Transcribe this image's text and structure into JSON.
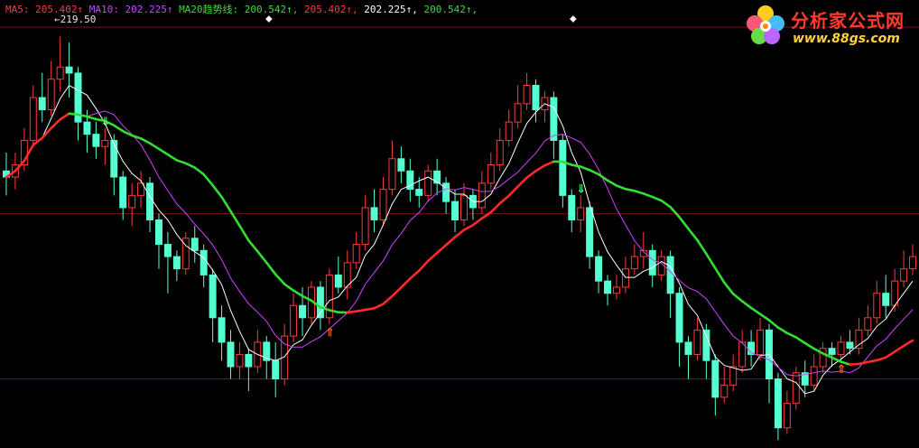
{
  "legend": {
    "ma5_label": "MA5: 205.402↑",
    "ma10_label": "MA10: 202.225↑",
    "ma20_label": "MA20趋势线: 200.542↑,",
    "extra_values": [
      {
        "text": "205.402↑,",
        "color": "#ff3a3a"
      },
      {
        "text": "202.225↑,",
        "color": "#ffffff"
      },
      {
        "text": "200.542↑,",
        "color": "#3ade3a"
      }
    ]
  },
  "high_label": "219.50",
  "watermark": {
    "title": "分析家公式网",
    "url": "www.88gs.com"
  },
  "colors": {
    "up": "#ff3a3a",
    "down": "#54ffd2",
    "ma5": "#ffffff",
    "ma10": "#cc44ff",
    "ma20_up": "#ff2a2a",
    "ma20_down": "#33dd33",
    "grid": "#7a1010",
    "ma5_text": "#ff3a3a",
    "ma10_text": "#cc44ff",
    "ma20_text": "#3ade3a"
  },
  "chart_data": {
    "type": "candlestick",
    "ylim": [
      155,
      225
    ],
    "grid_lines": [
      223.5,
      193,
      166
    ],
    "candles": [
      [
        200,
        199,
        203,
        196
      ],
      [
        199,
        201,
        203,
        197
      ],
      [
        201,
        205,
        207,
        200
      ],
      [
        205,
        212,
        214,
        204
      ],
      [
        212,
        210,
        216,
        208
      ],
      [
        210,
        215,
        218,
        209
      ],
      [
        215,
        217,
        222,
        213
      ],
      [
        217,
        216,
        221,
        212
      ],
      [
        216,
        208,
        217,
        205
      ],
      [
        208,
        206,
        210,
        203
      ],
      [
        206,
        204,
        208,
        202
      ],
      [
        204,
        205,
        207,
        201
      ],
      [
        205,
        199,
        206,
        196
      ],
      [
        199,
        194,
        200,
        192
      ],
      [
        194,
        196,
        198,
        191
      ],
      [
        196,
        198,
        200,
        194
      ],
      [
        198,
        192,
        199,
        190
      ],
      [
        192,
        188,
        193,
        184
      ],
      [
        188,
        186,
        190,
        180
      ],
      [
        186,
        184,
        187,
        182
      ],
      [
        184,
        189,
        190,
        183
      ],
      [
        189,
        187,
        191,
        185
      ],
      [
        187,
        183,
        188,
        181
      ],
      [
        183,
        176,
        184,
        172
      ],
      [
        176,
        172,
        178,
        169
      ],
      [
        172,
        168,
        174,
        166
      ],
      [
        168,
        170,
        172,
        166
      ],
      [
        170,
        168,
        171,
        164
      ],
      [
        168,
        172,
        174,
        167
      ],
      [
        172,
        169,
        173,
        166
      ],
      [
        169,
        166,
        172,
        163
      ],
      [
        166,
        173,
        175,
        165
      ],
      [
        173,
        178,
        180,
        172
      ],
      [
        178,
        176,
        181,
        173
      ],
      [
        176,
        181,
        182,
        175
      ],
      [
        181,
        176,
        182,
        174
      ],
      [
        176,
        183,
        184,
        175
      ],
      [
        183,
        181,
        186,
        180
      ],
      [
        181,
        185,
        187,
        179
      ],
      [
        185,
        188,
        190,
        184
      ],
      [
        188,
        194,
        196,
        187
      ],
      [
        194,
        192,
        197,
        190
      ],
      [
        192,
        197,
        199,
        191
      ],
      [
        197,
        202,
        205,
        196
      ],
      [
        202,
        200,
        204,
        198
      ],
      [
        200,
        197,
        202,
        195
      ],
      [
        197,
        196,
        199,
        194
      ],
      [
        196,
        200,
        201,
        195
      ],
      [
        200,
        198,
        202,
        196
      ],
      [
        198,
        195,
        199,
        193
      ],
      [
        195,
        192,
        197,
        190
      ],
      [
        192,
        196,
        198,
        191
      ],
      [
        196,
        194,
        197,
        192
      ],
      [
        194,
        198,
        200,
        193
      ],
      [
        198,
        201,
        203,
        197
      ],
      [
        201,
        205,
        207,
        200
      ],
      [
        205,
        208,
        210,
        204
      ],
      [
        208,
        211,
        214,
        207
      ],
      [
        211,
        214,
        216,
        210
      ],
      [
        214,
        210,
        215,
        208
      ],
      [
        210,
        212,
        213,
        208
      ],
      [
        212,
        205,
        213,
        202
      ],
      [
        205,
        196,
        206,
        194
      ],
      [
        196,
        192,
        197,
        190
      ],
      [
        192,
        194,
        196,
        190
      ],
      [
        194,
        186,
        195,
        184
      ],
      [
        186,
        182,
        187,
        180
      ],
      [
        182,
        180,
        183,
        178
      ],
      [
        180,
        181,
        183,
        179
      ],
      [
        181,
        184,
        186,
        180
      ],
      [
        184,
        186,
        188,
        183
      ],
      [
        186,
        187,
        190,
        184
      ],
      [
        187,
        183,
        188,
        181
      ],
      [
        183,
        186,
        187,
        182
      ],
      [
        186,
        180,
        187,
        176
      ],
      [
        180,
        172,
        181,
        168
      ],
      [
        172,
        170,
        173,
        166
      ],
      [
        170,
        174,
        176,
        169
      ],
      [
        174,
        169,
        175,
        166
      ],
      [
        169,
        163,
        170,
        160
      ],
      [
        163,
        165,
        168,
        162
      ],
      [
        165,
        168,
        170,
        164
      ],
      [
        168,
        172,
        174,
        167
      ],
      [
        172,
        170,
        174,
        168
      ],
      [
        170,
        174,
        176,
        169
      ],
      [
        174,
        166,
        175,
        162
      ],
      [
        166,
        158,
        167,
        156
      ],
      [
        158,
        162,
        164,
        157
      ],
      [
        162,
        167,
        168,
        161
      ],
      [
        167,
        165,
        169,
        163
      ],
      [
        165,
        168,
        170,
        164
      ],
      [
        168,
        171,
        172,
        167
      ],
      [
        171,
        170,
        172,
        168
      ],
      [
        170,
        172,
        173,
        169
      ],
      [
        172,
        171,
        174,
        170
      ],
      [
        171,
        174,
        176,
        170
      ],
      [
        174,
        176,
        178,
        173
      ],
      [
        176,
        180,
        182,
        175
      ],
      [
        180,
        178,
        183,
        176
      ],
      [
        178,
        182,
        184,
        177
      ],
      [
        182,
        184,
        187,
        181
      ],
      [
        184,
        186,
        188,
        183
      ]
    ]
  }
}
